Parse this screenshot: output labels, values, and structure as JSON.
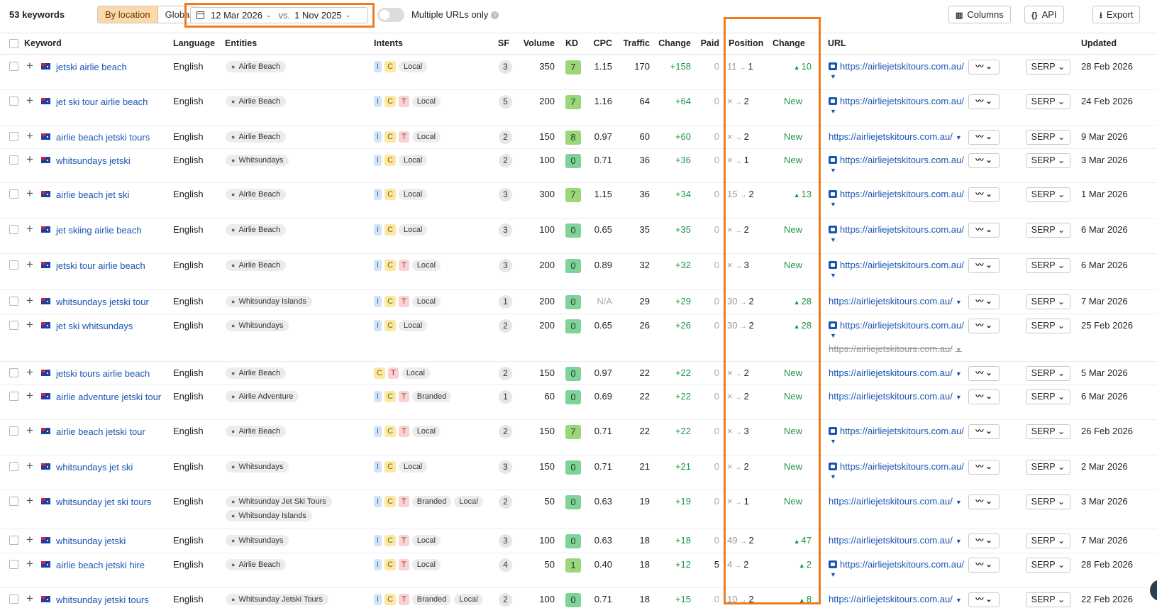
{
  "toolbar": {
    "keyword_count": "53 keywords",
    "by_location": "By location",
    "global": "Global",
    "date_current": "12 Mar 2026",
    "vs": "vs.",
    "date_compare": "1 Nov 2025",
    "multiple_urls_label": "Multiple URLs only",
    "columns": "Columns",
    "api": "API",
    "export": "Export"
  },
  "headers": {
    "keyword": "Keyword",
    "language": "Language",
    "entities": "Entities",
    "intents": "Intents",
    "sf": "SF",
    "volume": "Volume",
    "kd": "KD",
    "cpc": "CPC",
    "traffic": "Traffic",
    "change": "Change",
    "paid": "Paid",
    "position": "Position",
    "pos_change": "Change",
    "url": "URL",
    "updated": "Updated"
  },
  "rows": [
    {
      "keyword": "jetski airlie beach",
      "language": "English",
      "entities": [
        "Airlie Beach"
      ],
      "intents": [
        "I",
        "C"
      ],
      "tags": [
        "Local"
      ],
      "sf": "3",
      "volume": "350",
      "kd": "7",
      "cpc": "1.15",
      "traffic": "170",
      "change": "+158",
      "paid": "0",
      "pos_old": "11",
      "pos_new": "1",
      "pos_change": "10",
      "pos_is_new": false,
      "url": "https://airliejetskitours.com.au/",
      "url_img": true,
      "updated": "28 Feb 2026"
    },
    {
      "keyword": "jet ski tour airlie beach",
      "language": "English",
      "entities": [
        "Airlie Beach"
      ],
      "intents": [
        "I",
        "C",
        "T"
      ],
      "tags": [
        "Local"
      ],
      "sf": "5",
      "volume": "200",
      "kd": "7",
      "cpc": "1.16",
      "traffic": "64",
      "change": "+64",
      "paid": "0",
      "pos_old": "×",
      "pos_new": "2",
      "pos_change": "New",
      "pos_is_new": true,
      "url": "https://airliejetskitours.com.au/",
      "url_img": true,
      "updated": "24 Feb 2026"
    },
    {
      "keyword": "airlie beach jetski tours",
      "language": "English",
      "entities": [
        "Airlie Beach"
      ],
      "intents": [
        "I",
        "C",
        "T"
      ],
      "tags": [
        "Local"
      ],
      "sf": "2",
      "volume": "150",
      "kd": "8",
      "cpc": "0.97",
      "traffic": "60",
      "change": "+60",
      "paid": "0",
      "pos_old": "×",
      "pos_new": "2",
      "pos_change": "New",
      "pos_is_new": true,
      "url": "https://airliejetskitours.com.au/",
      "url_img": false,
      "updated": "9 Mar 2026"
    },
    {
      "keyword": "whitsundays jetski",
      "language": "English",
      "entities": [
        "Whitsundays"
      ],
      "intents": [
        "I",
        "C"
      ],
      "tags": [
        "Local"
      ],
      "sf": "2",
      "volume": "100",
      "kd": "0",
      "cpc": "0.71",
      "traffic": "36",
      "change": "+36",
      "paid": "0",
      "pos_old": "×",
      "pos_new": "1",
      "pos_change": "New",
      "pos_is_new": true,
      "url": "https://airliejetskitours.com.au/",
      "url_img": true,
      "updated": "3 Mar 2026"
    },
    {
      "keyword": "airlie beach jet ski",
      "language": "English",
      "entities": [
        "Airlie Beach"
      ],
      "intents": [
        "I",
        "C"
      ],
      "tags": [
        "Local"
      ],
      "sf": "3",
      "volume": "300",
      "kd": "7",
      "cpc": "1.15",
      "traffic": "36",
      "change": "+34",
      "paid": "0",
      "pos_old": "15",
      "pos_new": "2",
      "pos_change": "13",
      "pos_is_new": false,
      "url": "https://airliejetskitours.com.au/",
      "url_img": true,
      "updated": "1 Mar 2026"
    },
    {
      "keyword": "jet skiing airlie beach",
      "language": "English",
      "entities": [
        "Airlie Beach"
      ],
      "intents": [
        "I",
        "C"
      ],
      "tags": [
        "Local"
      ],
      "sf": "3",
      "volume": "100",
      "kd": "0",
      "cpc": "0.65",
      "traffic": "35",
      "change": "+35",
      "paid": "0",
      "pos_old": "×",
      "pos_new": "2",
      "pos_change": "New",
      "pos_is_new": true,
      "url": "https://airliejetskitours.com.au/",
      "url_img": true,
      "updated": "6 Mar 2026"
    },
    {
      "keyword": "jetski tour airlie beach",
      "language": "English",
      "entities": [
        "Airlie Beach"
      ],
      "intents": [
        "I",
        "C",
        "T"
      ],
      "tags": [
        "Local"
      ],
      "sf": "3",
      "volume": "200",
      "kd": "0",
      "cpc": "0.89",
      "traffic": "32",
      "change": "+32",
      "paid": "0",
      "pos_old": "×",
      "pos_new": "3",
      "pos_change": "New",
      "pos_is_new": true,
      "url": "https://airliejetskitours.com.au/",
      "url_img": true,
      "updated": "6 Mar 2026"
    },
    {
      "keyword": "whitsundays jetski tour",
      "language": "English",
      "entities": [
        "Whitsunday Islands"
      ],
      "intents": [
        "I",
        "C",
        "T"
      ],
      "tags": [
        "Local"
      ],
      "sf": "1",
      "volume": "200",
      "kd": "0",
      "cpc": "N/A",
      "traffic": "29",
      "change": "+29",
      "paid": "0",
      "pos_old": "30",
      "pos_new": "2",
      "pos_change": "28",
      "pos_is_new": false,
      "url": "https://airliejetskitours.com.au/",
      "url_img": false,
      "updated": "7 Mar 2026"
    },
    {
      "keyword": "jet ski whitsundays",
      "language": "English",
      "entities": [
        "Whitsundays"
      ],
      "intents": [
        "I",
        "C"
      ],
      "tags": [
        "Local"
      ],
      "sf": "2",
      "volume": "200",
      "kd": "0",
      "cpc": "0.65",
      "traffic": "26",
      "change": "+26",
      "paid": "0",
      "pos_old": "30",
      "pos_new": "2",
      "pos_change": "28",
      "pos_is_new": false,
      "url": "https://airliejetskitours.com.au/",
      "url_img": true,
      "url_old": "https://airliejetskitours.com.au/",
      "updated": "25 Feb 2026"
    },
    {
      "keyword": "jetski tours airlie beach",
      "language": "English",
      "entities": [
        "Airlie Beach"
      ],
      "intents": [
        "C",
        "T"
      ],
      "tags": [
        "Local"
      ],
      "sf": "2",
      "volume": "150",
      "kd": "0",
      "cpc": "0.97",
      "traffic": "22",
      "change": "+22",
      "paid": "0",
      "pos_old": "×",
      "pos_new": "2",
      "pos_change": "New",
      "pos_is_new": true,
      "url": "https://airliejetskitours.com.au/",
      "url_img": false,
      "updated": "5 Mar 2026"
    },
    {
      "keyword": "airlie adventure jetski tour",
      "language": "English",
      "entities": [
        "Airlie Adventure"
      ],
      "intents": [
        "I",
        "C",
        "T"
      ],
      "tags": [
        "Branded"
      ],
      "sf": "1",
      "volume": "60",
      "kd": "0",
      "cpc": "0.69",
      "traffic": "22",
      "change": "+22",
      "paid": "0",
      "pos_old": "×",
      "pos_new": "2",
      "pos_change": "New",
      "pos_is_new": true,
      "url": "https://airliejetskitours.com.au/",
      "url_img": false,
      "updated": "6 Mar 2026"
    },
    {
      "keyword": "airlie beach jetski tour",
      "language": "English",
      "entities": [
        "Airlie Beach"
      ],
      "intents": [
        "I",
        "C",
        "T"
      ],
      "tags": [
        "Local"
      ],
      "sf": "2",
      "volume": "150",
      "kd": "7",
      "cpc": "0.71",
      "traffic": "22",
      "change": "+22",
      "paid": "0",
      "pos_old": "×",
      "pos_new": "3",
      "pos_change": "New",
      "pos_is_new": true,
      "url": "https://airliejetskitours.com.au/",
      "url_img": true,
      "updated": "26 Feb 2026"
    },
    {
      "keyword": "whitsundays jet ski",
      "language": "English",
      "entities": [
        "Whitsundays"
      ],
      "intents": [
        "I",
        "C"
      ],
      "tags": [
        "Local"
      ],
      "sf": "3",
      "volume": "150",
      "kd": "0",
      "cpc": "0.71",
      "traffic": "21",
      "change": "+21",
      "paid": "0",
      "pos_old": "×",
      "pos_new": "2",
      "pos_change": "New",
      "pos_is_new": true,
      "url": "https://airliejetskitours.com.au/",
      "url_img": true,
      "updated": "2 Mar 2026"
    },
    {
      "keyword": "whitsunday jet ski tours",
      "language": "English",
      "entities": [
        "Whitsunday Jet Ski Tours",
        "Whitsunday Islands"
      ],
      "intents": [
        "I",
        "C",
        "T"
      ],
      "tags": [
        "Branded",
        "Local"
      ],
      "sf": "2",
      "volume": "50",
      "kd": "0",
      "cpc": "0.63",
      "traffic": "19",
      "change": "+19",
      "paid": "0",
      "pos_old": "×",
      "pos_new": "1",
      "pos_change": "New",
      "pos_is_new": true,
      "url": "https://airliejetskitours.com.au/",
      "url_img": false,
      "updated": "3 Mar 2026"
    },
    {
      "keyword": "whitsunday jetski",
      "language": "English",
      "entities": [
        "Whitsundays"
      ],
      "intents": [
        "I",
        "C",
        "T"
      ],
      "tags": [
        "Local"
      ],
      "sf": "3",
      "volume": "100",
      "kd": "0",
      "cpc": "0.63",
      "traffic": "18",
      "change": "+18",
      "paid": "0",
      "pos_old": "49",
      "pos_new": "2",
      "pos_change": "47",
      "pos_is_new": false,
      "url": "https://airliejetskitours.com.au/",
      "url_img": false,
      "updated": "7 Mar 2026"
    },
    {
      "keyword": "airlie beach jetski hire",
      "language": "English",
      "entities": [
        "Airlie Beach"
      ],
      "intents": [
        "I",
        "C",
        "T"
      ],
      "tags": [
        "Local"
      ],
      "sf": "4",
      "volume": "50",
      "kd": "1",
      "cpc": "0.40",
      "traffic": "18",
      "change": "+12",
      "paid": "5",
      "pos_old": "4",
      "pos_new": "2",
      "pos_change": "2",
      "pos_is_new": false,
      "url": "https://airliejetskitours.com.au/",
      "url_img": true,
      "updated": "28 Feb 2026"
    },
    {
      "keyword": "whitsunday jetski tours",
      "language": "English",
      "entities": [
        "Whitsunday Jetski Tours"
      ],
      "intents": [
        "I",
        "C",
        "T"
      ],
      "tags": [
        "Branded",
        "Local"
      ],
      "sf": "2",
      "volume": "100",
      "kd": "0",
      "cpc": "0.71",
      "traffic": "18",
      "change": "+15",
      "paid": "0",
      "pos_old": "10",
      "pos_new": "2",
      "pos_change": "8",
      "pos_is_new": false,
      "url": "https://airliejetskitours.com.au/",
      "url_img": false,
      "updated": "22 Feb 2026"
    }
  ],
  "row_actions": {
    "graph": "〰",
    "serp": "SERP"
  }
}
